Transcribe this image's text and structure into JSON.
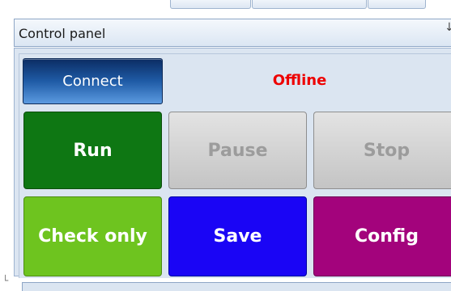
{
  "panel": {
    "title": "Control panel",
    "pin_glyph": "↓"
  },
  "connect": {
    "label": "Connect"
  },
  "status": {
    "text": "Offline",
    "color": "#ee0000"
  },
  "buttons": {
    "run": {
      "label": "Run",
      "color": "#0e7713"
    },
    "pause": {
      "label": "Pause",
      "color": "#c4c4c4"
    },
    "stop": {
      "label": "Stop",
      "color": "#c4c4c4"
    },
    "check_only": {
      "label": "Check only",
      "color": "#6ec41f"
    },
    "save": {
      "label": "Save",
      "color": "#1a05f5"
    },
    "config": {
      "label": "Config",
      "color": "#a3037c"
    }
  },
  "corner_glyph": "└",
  "icons": {
    "pin": "pin-icon",
    "resize": "resize-grip-icon"
  }
}
